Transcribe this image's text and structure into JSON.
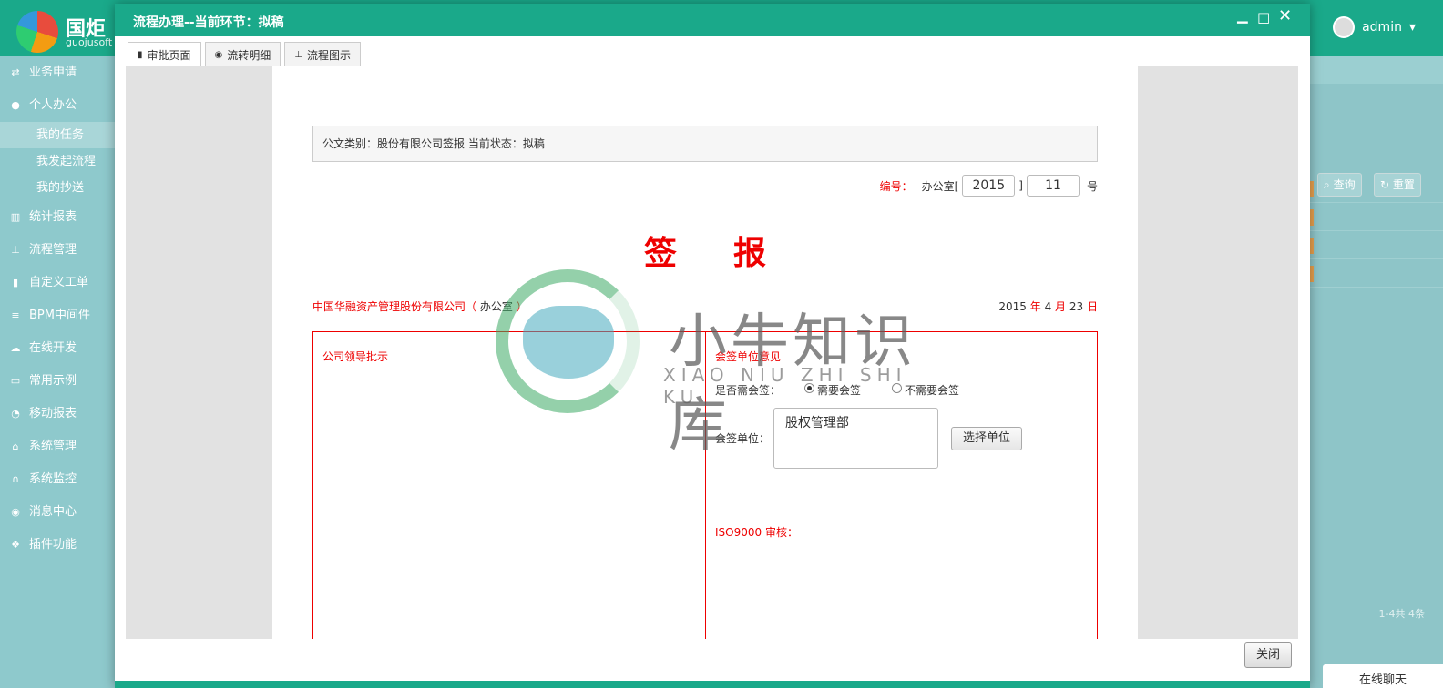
{
  "app": {
    "logo_text": "国炬",
    "logo_sub": "guojusoft",
    "user": "admin"
  },
  "sidebar": {
    "items": [
      {
        "label": "业务申请",
        "icon": "shuffle-icon"
      },
      {
        "label": "个人办公",
        "icon": "user-icon"
      },
      {
        "label": "统计报表",
        "icon": "bar-chart-icon"
      },
      {
        "label": "流程管理",
        "icon": "sitemap-icon"
      },
      {
        "label": "自定义工单",
        "icon": "book-icon"
      },
      {
        "label": "BPM中间件",
        "icon": "database-icon"
      },
      {
        "label": "在线开发",
        "icon": "cloud-icon"
      },
      {
        "label": "常用示例",
        "icon": "chat-icon"
      },
      {
        "label": "移动报表",
        "icon": "pie-icon"
      },
      {
        "label": "系统管理",
        "icon": "home-icon"
      },
      {
        "label": "系统监控",
        "icon": "headset-icon"
      },
      {
        "label": "消息中心",
        "icon": "comment-icon"
      },
      {
        "label": "插件功能",
        "icon": "cubes-icon"
      }
    ],
    "sub_items": [
      "我的任务",
      "我发起流程",
      "我的抄送"
    ]
  },
  "bg_right": {
    "query_label": "查询",
    "reset_label": "重置",
    "pager": "1-4共 4条",
    "chat_label": "在线聊天"
  },
  "modal": {
    "title": "流程办理--当前环节：拟稿",
    "tabs": [
      {
        "label": "审批页面",
        "icon": "book-icon"
      },
      {
        "label": "流转明细",
        "icon": "eye-icon"
      },
      {
        "label": "流程图示",
        "icon": "sitemap-icon"
      }
    ],
    "close_label": "关闭"
  },
  "doc": {
    "info": "公文类别：股份有限公司签报    当前状态：拟稿",
    "number_label": "编号：",
    "office_prefix": "办公室[",
    "year_value": "2015",
    "bracket_close": "]",
    "serial_value": "11",
    "suffix": "号",
    "title": "签报",
    "company": "中国华融资产管理股份有限公司（",
    "dept": "办公室",
    "company_close": "）",
    "date_year": "2015",
    "date_year_unit": "年",
    "date_month": "4",
    "date_month_unit": "月",
    "date_day": "23",
    "date_day_unit": "日",
    "leader_label": "公司领导批示",
    "cosign_label": "会签单位意见",
    "need_cosign_label": "是否需会签：",
    "radio_yes": "需要会签",
    "radio_no": "不需要会签",
    "unit_label": "会签单位：",
    "unit_value": "股权管理部",
    "select_unit_label": "选择单位",
    "iso_label": "ISO9000 审核："
  },
  "watermark": {
    "text": "小牛知识库",
    "sub": "XIAO NIU ZHI SHI KU"
  }
}
